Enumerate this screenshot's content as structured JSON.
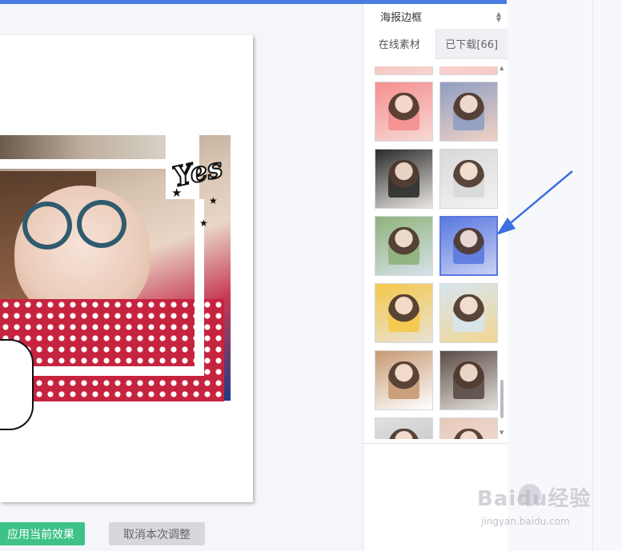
{
  "panel": {
    "dropdown_label": "海报边框",
    "tabs": [
      {
        "label": "在线素材",
        "active": true
      },
      {
        "label": "已下载[66]",
        "active": false
      }
    ]
  },
  "canvas": {
    "sticker_text": "Yes"
  },
  "buttons": {
    "apply": "应用当前效果",
    "cancel": "取消本次调整"
  },
  "thumbnails": [
    {
      "name": "pink-strip-left",
      "colors": [
        "#f4b3b0",
        "#f7d4cf"
      ]
    },
    {
      "name": "pink-strip-right",
      "colors": [
        "#fbe3e0",
        "#f8c9c5"
      ]
    },
    {
      "name": "pink-double-photo",
      "colors": [
        "#f58f8f",
        "#f6d9d4"
      ]
    },
    {
      "name": "scalloped-hat-girl",
      "colors": [
        "#8f9ec2",
        "#f1d2c4"
      ]
    },
    {
      "name": "curly-hair-poster",
      "colors": [
        "#2b2b2b",
        "#e9e6e0"
      ]
    },
    {
      "name": "smile-frame",
      "colors": [
        "#d8d8d8",
        "#f3f3f3"
      ]
    },
    {
      "name": "field-poster",
      "colors": [
        "#8fb27a",
        "#d7e1ea"
      ]
    },
    {
      "name": "glitch-frame",
      "colors": [
        "#5a78e0",
        "#c9d1f4"
      ],
      "selected": true
    },
    {
      "name": "dreams-collage",
      "colors": [
        "#f5c84a",
        "#e8e2d6"
      ]
    },
    {
      "name": "yellow-dress-room",
      "colors": [
        "#d7e6ef",
        "#f2d694"
      ]
    },
    {
      "name": "heart-hat-girl",
      "colors": [
        "#c79a73",
        "#ffffff"
      ]
    },
    {
      "name": "film-strip-dog",
      "colors": [
        "#5b4b45",
        "#e5e1dc"
      ]
    },
    {
      "name": "partial-bottom-left",
      "colors": [
        "#e0e0e0",
        "#bdbdbd"
      ]
    },
    {
      "name": "partial-bottom-right",
      "colors": [
        "#e8c9bb",
        "#f2e5de"
      ]
    }
  ],
  "watermark": {
    "brand": "Baidu经验",
    "url": "jingyan.baidu.com"
  }
}
